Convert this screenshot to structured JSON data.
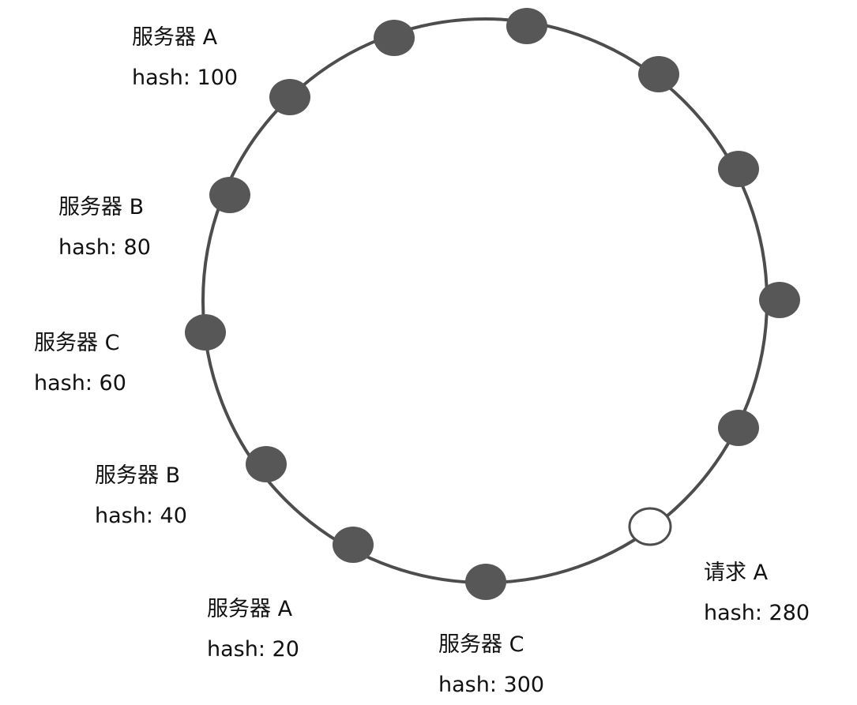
{
  "colors": {
    "ring": "#4d4d4d",
    "node_fill": "#575757",
    "request_fill": "#ffffff",
    "text": "#111111"
  },
  "ring_nodes": [
    {
      "kind": "server"
    },
    {
      "kind": "server"
    },
    {
      "kind": "server"
    },
    {
      "kind": "server"
    },
    {
      "kind": "server"
    },
    {
      "kind": "server"
    },
    {
      "kind": "server"
    },
    {
      "kind": "server"
    },
    {
      "kind": "request"
    },
    {
      "kind": "server"
    },
    {
      "kind": "server"
    },
    {
      "kind": "server"
    },
    {
      "kind": "server"
    },
    {
      "kind": "server"
    }
  ],
  "labels": [
    {
      "name": "服务器 A",
      "hash": "hash: 100"
    },
    {
      "name": "服务器 B",
      "hash": "hash: 80"
    },
    {
      "name": "服务器 C",
      "hash": "hash: 60"
    },
    {
      "name": "服务器 B",
      "hash": "hash: 40"
    },
    {
      "name": "服务器 A",
      "hash": "hash: 20"
    },
    {
      "name": "服务器 C",
      "hash": "hash: 300"
    },
    {
      "name": "请求 A",
      "hash": "hash: 280"
    }
  ]
}
